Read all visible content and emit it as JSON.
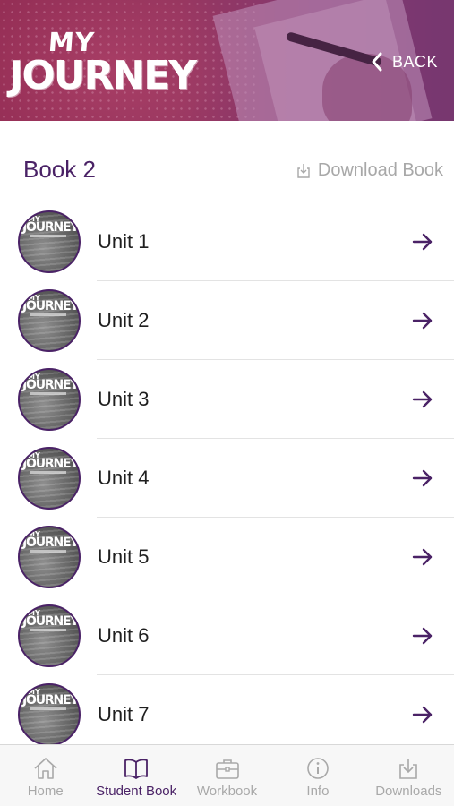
{
  "header": {
    "logo_top": "MY",
    "logo_main": "JOURNEY",
    "back_label": "BACK",
    "back_icon": "chevron-left-icon"
  },
  "section": {
    "title": "Book 2",
    "download_label": "Download Book",
    "download_icon": "download-icon"
  },
  "units": [
    {
      "label": "Unit 1"
    },
    {
      "label": "Unit 2"
    },
    {
      "label": "Unit 3"
    },
    {
      "label": "Unit 4"
    },
    {
      "label": "Unit 5"
    },
    {
      "label": "Unit 6"
    },
    {
      "label": "Unit 7"
    }
  ],
  "unit_thumbnail": {
    "top": "MY",
    "main": "JOURNEY"
  },
  "tabs": [
    {
      "label": "Home",
      "icon": "home-icon",
      "active": false
    },
    {
      "label": "Student Book",
      "icon": "book-icon",
      "active": true
    },
    {
      "label": "Workbook",
      "icon": "briefcase-icon",
      "active": false
    },
    {
      "label": "Info",
      "icon": "info-icon",
      "active": false
    },
    {
      "label": "Downloads",
      "icon": "download-icon",
      "active": false
    }
  ],
  "colors": {
    "accent": "#4a2266",
    "inactive": "#a9a9a9",
    "banner": "#a0304f"
  }
}
